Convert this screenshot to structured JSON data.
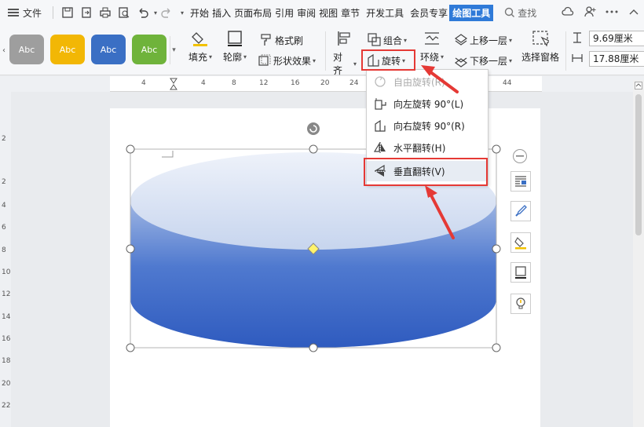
{
  "menubar": {
    "file_label": "文件",
    "tabs": [
      "开始",
      "插入",
      "页面布局",
      "引用",
      "审阅",
      "视图",
      "章节",
      "开发工具",
      "会员专享",
      "绘图工具"
    ],
    "active_tab": "绘图工具",
    "search_label": "查找"
  },
  "ribbon": {
    "styles": [
      {
        "label": "Abc",
        "color": "#9e9e9e"
      },
      {
        "label": "Abc",
        "color": "#f2b705"
      },
      {
        "label": "Abc",
        "color": "#3a6fc4"
      },
      {
        "label": "Abc",
        "color": "#6fb33b"
      }
    ],
    "fill_label": "填充",
    "outline_label": "轮廓",
    "format_painter_label": "格式刷",
    "shape_effects_label": "形状效果",
    "align_label": "对齐",
    "group_label": "组合",
    "rotate_label": "旋转",
    "wrap_label": "环绕",
    "bring_forward_label": "上移一层",
    "send_backward_label": "下移一层",
    "selection_pane_label": "选择窗格",
    "height_value": "9.69厘米",
    "width_value": "17.88厘米"
  },
  "ruler": {
    "ticks": [
      "4",
      "4",
      "8",
      "12",
      "16",
      "20",
      "24",
      "44"
    ]
  },
  "vruler": {
    "ticks": [
      "2",
      "2",
      "4",
      "6",
      "8",
      "10",
      "12",
      "14",
      "16",
      "18",
      "20",
      "22"
    ]
  },
  "rotate_menu": {
    "items": [
      {
        "label": "自由旋转(R)",
        "disabled": true
      },
      {
        "label": "向左旋转 90°(L)",
        "disabled": false
      },
      {
        "label": "向右旋转 90°(R)",
        "disabled": false
      },
      {
        "label": "水平翻转(H)",
        "disabled": false
      },
      {
        "label": "垂直翻转(V)",
        "disabled": false
      }
    ]
  },
  "colors": {
    "accent": "#2f7ad8",
    "highlight_red": "#e53935",
    "cylinder_top": "#dfe7f5",
    "cylinder_body": "#3561c2"
  }
}
